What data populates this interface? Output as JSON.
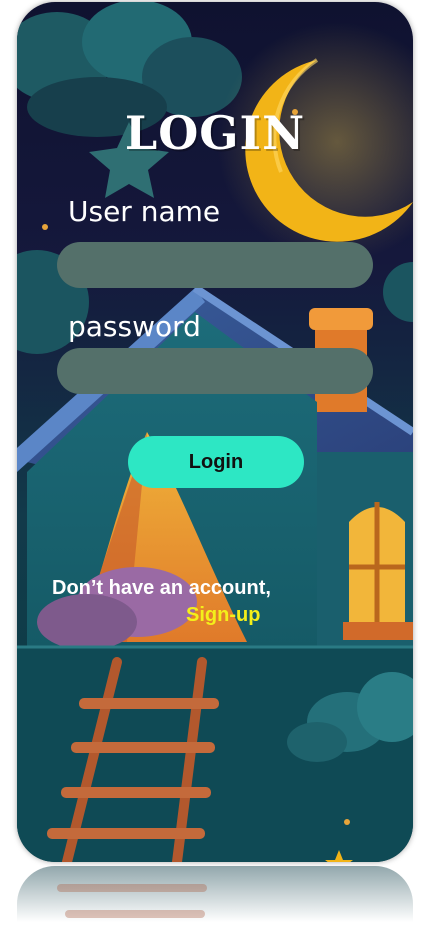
{
  "screen": {
    "title": "LOGIN",
    "username_label": "User name",
    "username_value": "",
    "password_label": "password",
    "password_value": "",
    "login_button": "Login",
    "no_account_text": "Don’t have an account,",
    "signup_link": "Sign-up"
  },
  "colors": {
    "input_fill": "#54706a",
    "button_fill": "#2de7c4",
    "signup_color": "#f4ef1a",
    "moon": "#f2b417",
    "background": "#15183c"
  }
}
